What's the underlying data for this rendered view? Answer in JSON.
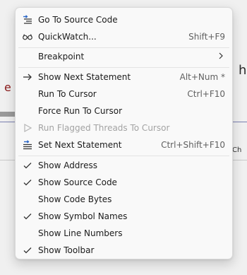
{
  "background": {
    "left_fragment": "e",
    "right_fragment": "h",
    "small_fragment": "Ch"
  },
  "menu": {
    "items": [
      {
        "label": "Go To Source Code",
        "shortcut": "",
        "icon": "source-code-icon",
        "disabled": false
      },
      {
        "label": "QuickWatch...",
        "shortcut": "Shift+F9",
        "icon": "glasses-icon",
        "disabled": false
      },
      {
        "label": "Breakpoint",
        "shortcut": "",
        "icon": "",
        "submenu": true,
        "disabled": false
      },
      {
        "label": "Show Next Statement",
        "shortcut": "Alt+Num *",
        "icon": "arrow-right-icon",
        "disabled": false
      },
      {
        "label": "Run To Cursor",
        "shortcut": "Ctrl+F10",
        "icon": "",
        "disabled": false
      },
      {
        "label": "Force Run To Cursor",
        "shortcut": "",
        "icon": "",
        "disabled": false
      },
      {
        "label": "Run Flagged Threads To Cursor",
        "shortcut": "",
        "icon": "play-outline-icon",
        "disabled": true
      },
      {
        "label": "Set Next Statement",
        "shortcut": "Ctrl+Shift+F10",
        "icon": "set-next-statement-icon",
        "disabled": false
      },
      {
        "label": "Show Address",
        "checked": true
      },
      {
        "label": "Show Source Code",
        "checked": true
      },
      {
        "label": "Show Code Bytes",
        "checked": false
      },
      {
        "label": "Show Symbol Names",
        "checked": true
      },
      {
        "label": "Show Line Numbers",
        "checked": false
      },
      {
        "label": "Show Toolbar",
        "checked": true
      }
    ],
    "submenu_glyph": "›"
  }
}
